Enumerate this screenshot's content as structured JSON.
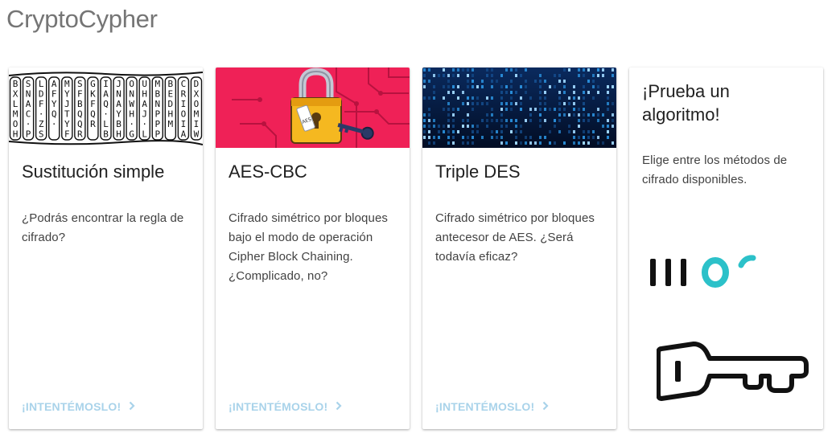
{
  "app": {
    "title": "CryptoCypher"
  },
  "cards": [
    {
      "media": "cipher-grid-image",
      "title": "Sustitución simple",
      "description": "¿Podrás encontrar la regla de cifrado?",
      "action": "¡INTENTÉMOSLO!",
      "grid_columns": [
        "BXLMOH",
        "SNAC·P",
        "LDF·ZS",
        "AF Y Q·",
        "MY J T Y F",
        "SFBQQR",
        "GKFQ R",
        "I AQ·L B",
        "JNAYBH",
        "ONWH·G",
        "UHAJ·L",
        "MBNPPP",
        "BEDH M",
        "CRIOIA",
        "DXOMIW"
      ]
    },
    {
      "media": "padlock-image",
      "title": "AES-CBC",
      "description": "Cifrado simétrico por bloques bajo el modo de operación Cipher Block Chaining. ¿Complicado, no?",
      "action": "¡INTENTÉMOSLO!",
      "tag_label": "AES"
    },
    {
      "media": "binary-code-image",
      "title": "Triple DES",
      "description": "Cifrado simétrico por bloques antecesor de AES. ¿Será todavía eficaz?",
      "action": "¡INTENTÉMOSLO!"
    },
    {
      "title": "¡Prueba un algoritmo!",
      "description": "Elige entre los métodos de cifrado disponibles."
    }
  ],
  "colors": {
    "accent_link": "#a9d3ea",
    "aes_background": "#ef2157",
    "lock_gold": "#f5b820",
    "binary_background": "#031a3d",
    "binary_glow": "#2f9ff0",
    "promo_teal": "#2cc1c9"
  }
}
